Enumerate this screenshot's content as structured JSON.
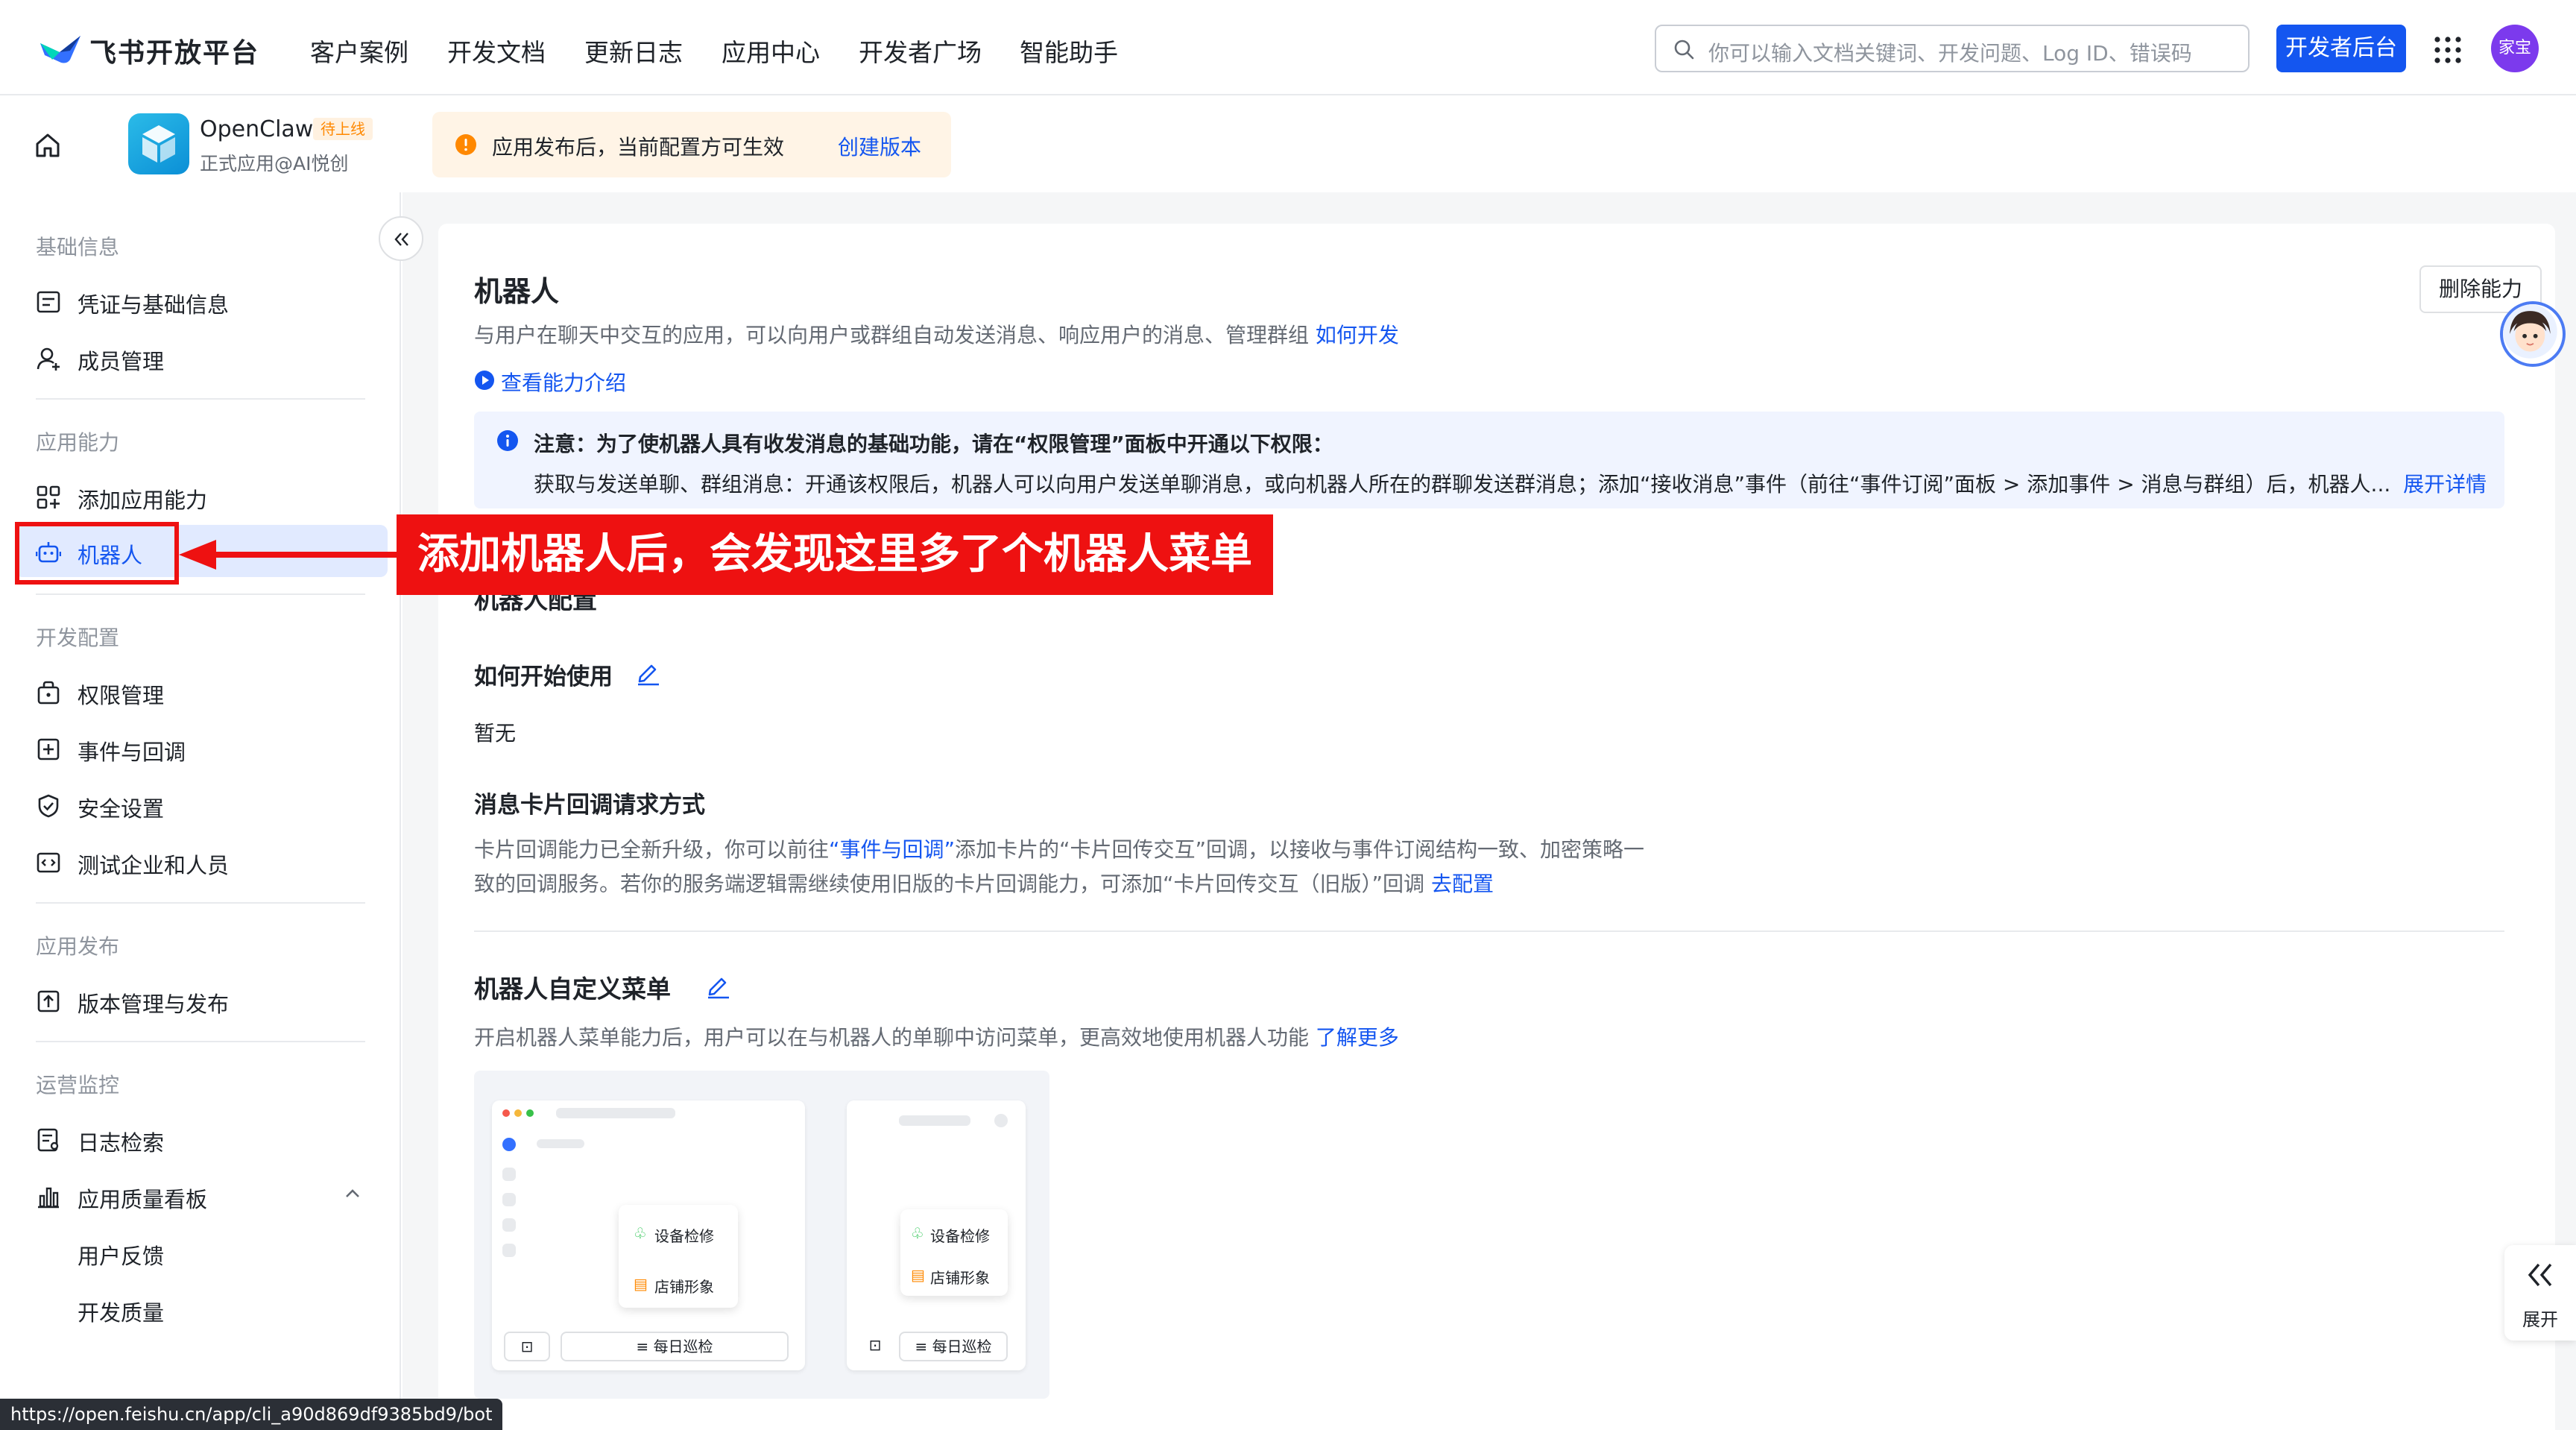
{
  "brand": {
    "name": "飞书开放平台"
  },
  "nav": {
    "items": [
      "客户案例",
      "开发文档",
      "更新日志",
      "应用中心",
      "开发者广场",
      "智能助手"
    ]
  },
  "search": {
    "placeholder": "你可以输入文档关键词、开发问题、Log ID、错误码"
  },
  "header_buttons": {
    "dev_console": "开发者后台",
    "avatar_text": "家宝"
  },
  "app": {
    "name": "OpenClaw",
    "status_badge": "待上线",
    "owner": "正式应用@AI悦创"
  },
  "notice": {
    "text": "应用发布后，当前配置方可生效",
    "link": "创建版本"
  },
  "sidebar": {
    "groups": [
      {
        "title": "基础信息",
        "items": [
          "凭证与基础信息",
          "成员管理"
        ]
      },
      {
        "title": "应用能力",
        "items": [
          "添加应用能力",
          "机器人"
        ]
      },
      {
        "title": "开发配置",
        "items": [
          "权限管理",
          "事件与回调",
          "安全设置",
          "测试企业和人员"
        ]
      },
      {
        "title": "应用发布",
        "items": [
          "版本管理与发布"
        ]
      },
      {
        "title": "运营监控",
        "items": [
          "日志检索",
          "应用质量看板",
          "用户反馈",
          "开发质量"
        ]
      }
    ],
    "active_item": "机器人"
  },
  "content": {
    "title": "机器人",
    "delete_button": "删除能力",
    "description": "与用户在聊天中交互的应用，可以向用户或群组自动发送消息、响应用户的消息、管理群组",
    "description_link": "如何开发",
    "intro_link": "查看能力介绍",
    "info": {
      "line1": "注意：为了使机器人具有收发消息的基础功能，请在“权限管理”面板中开通以下权限：",
      "line2": "获取与发送单聊、群组消息：开通该权限后，机器人可以向用户发送单聊消息，或向机器人所在的群聊发送群消息；添加“接收消息”事件（前往“事件订阅”面板 > 添加事件 > 消息与群组）后，机器人...",
      "line2_link": "展开详情"
    },
    "config_title": "机器人配置",
    "how_to_start": {
      "title": "如何开始使用",
      "value": "暂无"
    },
    "card_callback": {
      "title": "消息卡片回调请求方式",
      "line1_a": "卡片回调能力已全新升级，你可以前往",
      "line1_link": "“事件与回调”",
      "line1_b": "添加卡片的“卡片回传交互”回调，以接收与事件订阅结构一致、加密策略一",
      "line2": "致的回调服务。若你的服务端逻辑需继续使用旧版的卡片回调能力，可添加“卡片回传交互（旧版）”回调",
      "line2_link": "去配置"
    },
    "custom_menu": {
      "title": "机器人自定义菜单",
      "description": "开启机器人菜单能力后，用户可以在与机器人的单聊中访问菜单，更高效地使用机器人功能",
      "link": "了解更多",
      "preview": {
        "menu_item_1": "设备检修",
        "menu_item_2": "店铺形象",
        "bottom_button": "每日巡检"
      }
    }
  },
  "annotation": {
    "text": "添加机器人后，会发现这里多了个机器人菜单"
  },
  "float": {
    "expand": "展开"
  },
  "status_url": "https://open.feishu.cn/app/cli_a90d869df9385bd9/bot"
}
